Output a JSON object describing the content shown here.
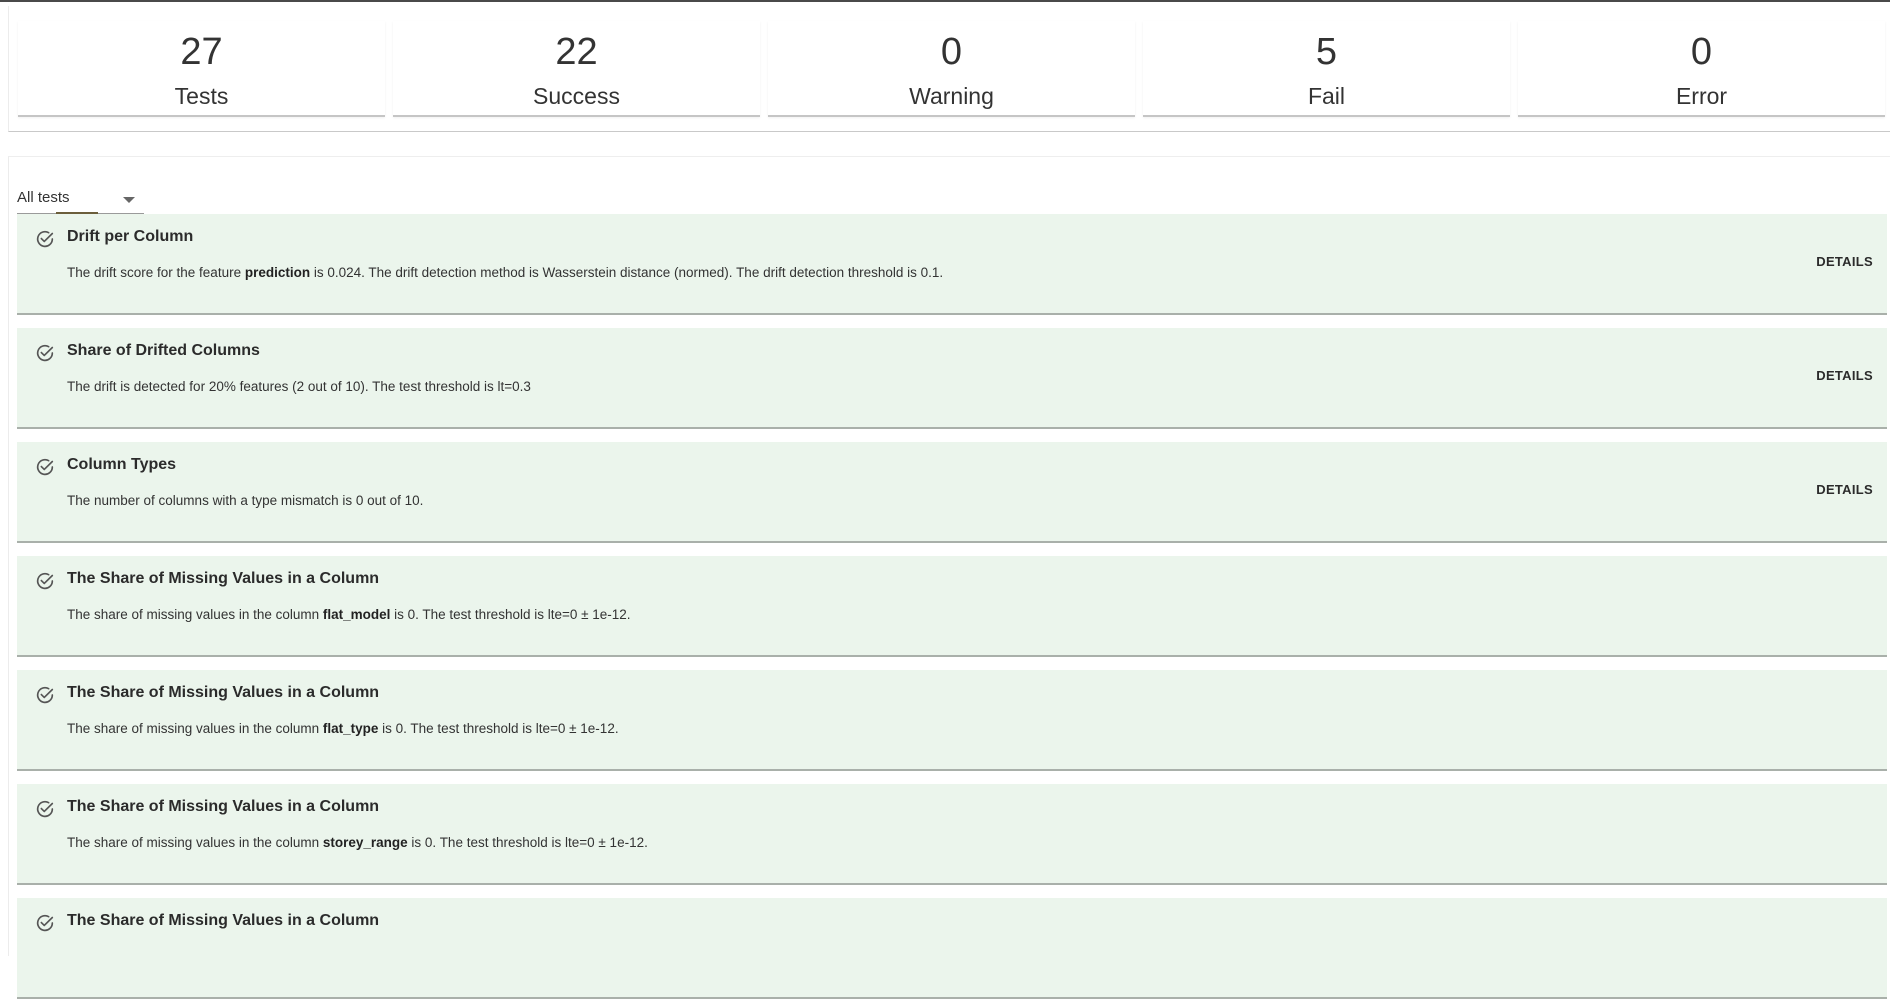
{
  "summary": [
    {
      "count": "27",
      "label": "Tests"
    },
    {
      "count": "22",
      "label": "Success"
    },
    {
      "count": "0",
      "label": "Warning"
    },
    {
      "count": "5",
      "label": "Fail"
    },
    {
      "count": "0",
      "label": "Error"
    }
  ],
  "filter": {
    "value": "All tests"
  },
  "details_label": "DETAILS",
  "colors": {
    "card_background": "#ebf5ec",
    "success_icon": "#555555"
  },
  "tests": [
    {
      "title": "Drift per Column",
      "desc": [
        "The drift score for the feature ",
        "prediction",
        " is 0.024. The drift detection method is Wasserstein distance (normed). The drift detection threshold is 0.1."
      ]
    },
    {
      "title": "Share of Drifted Columns",
      "desc": [
        "The drift is detected for 20% features (2 out of 10). The test threshold is lt=0.3",
        "",
        ""
      ]
    },
    {
      "title": "Column Types",
      "desc": [
        "The number of columns with a type mismatch is 0 out of 10.",
        "",
        ""
      ]
    },
    {
      "title": "The Share of Missing Values in a Column",
      "desc": [
        "The share of missing values in the column ",
        "flat_model",
        " is 0. The test threshold is lte=0 ± 1e-12."
      ]
    },
    {
      "title": "The Share of Missing Values in a Column",
      "desc": [
        "The share of missing values in the column ",
        "flat_type",
        " is 0. The test threshold is lte=0 ± 1e-12."
      ]
    },
    {
      "title": "The Share of Missing Values in a Column",
      "desc": [
        "The share of missing values in the column ",
        "storey_range",
        " is 0. The test threshold is lte=0 ± 1e-12."
      ]
    },
    {
      "title": "The Share of Missing Values in a Column",
      "desc": [
        "",
        "",
        ""
      ]
    }
  ]
}
